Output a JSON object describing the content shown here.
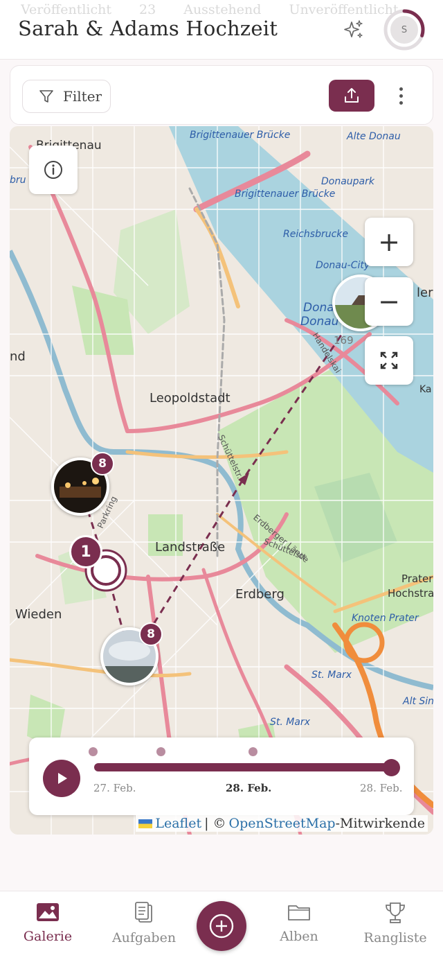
{
  "header": {
    "title": "Sarah & Adams Hochzeit",
    "ghost_tabs": [
      "Veröffentlicht",
      "23",
      "Ausstehend",
      "Unveröffentlicht"
    ],
    "avatar_initial": "S",
    "avatar_progress_percent": 30
  },
  "toolbar": {
    "filter_label": "Filter",
    "upload_icon": "upload-icon",
    "more_icon": "more-vertical-icon"
  },
  "map": {
    "place_labels": {
      "brigittenau": "Brigittenau",
      "brigittenauer_bruecke_1": "Brigittenauer Brücke",
      "alte_donau": "Alte Donau",
      "donaupark": "Donaupark",
      "brigittenauer_bruecke_2": "Brigittenauer Brücke",
      "reichsbrucke": "Reichsbrucke",
      "donau_city": "Donau-City",
      "donau_1": "Donau",
      "donau_2": "Donau",
      "handelskai": "Handelskai",
      "leopoldstadt": "Leopoldstadt",
      "schuettelstr_1": "Schüttelstr.",
      "erdberger_lande": "Erdberger Lände",
      "schuettelstr_2": "Schüttelstr.",
      "landstrasse": "Landstraße",
      "erdberg": "Erdberg",
      "wieden": "Wieden",
      "parkring": "Parkring",
      "prater": "Prater",
      "hochstra": "Hochstra",
      "knoten_prater": "Knoten Prater",
      "st_marx_1": "St. Marx",
      "st_marx_2": "St. Marx",
      "alt_sim": "Alt Sin",
      "nd": "nd",
      "bru": "bru",
      "ler": "ler",
      "ka": "Ka",
      "number_169": "169"
    },
    "zoom_in": "+",
    "zoom_out": "−",
    "clusters": [
      {
        "count": "8"
      },
      {
        "count": "8"
      }
    ],
    "single_marker_count": "1"
  },
  "timeline": {
    "dates": [
      "27. Feb.",
      "28. Feb.",
      "28. Feb."
    ],
    "active_index": 1,
    "progress_fraction": 1.0
  },
  "attribution": {
    "leaflet": "Leaflet",
    "separator": "| ©",
    "osm": "OpenStreetMap",
    "suffix": "-Mitwirkende"
  },
  "nav": {
    "items": [
      "Galerie",
      "Aufgaben",
      "Alben",
      "Rangliste"
    ],
    "active": "Galerie"
  },
  "colors": {
    "accent": "#7a2e4f",
    "water": "#aad3df",
    "park": "#c8e6b5"
  }
}
